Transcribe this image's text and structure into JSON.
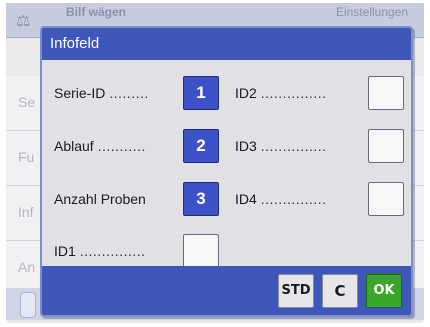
{
  "background": {
    "header_left": "Bilf wägen",
    "header_right": "Einstellungen",
    "rows": [
      "Se",
      "Fu",
      "Inf",
      "An"
    ]
  },
  "dialog": {
    "title": "Infofeld",
    "left_fields": [
      {
        "label": "Serie-ID",
        "dots": ".........",
        "value": "1"
      },
      {
        "label": "Ablauf",
        "dots": "...........",
        "value": "2"
      },
      {
        "label": "Anzahl Proben",
        "dots": "",
        "value": "3"
      },
      {
        "label": "ID1",
        "dots": "...............",
        "value": ""
      }
    ],
    "right_fields": [
      {
        "label": "ID2",
        "dots": "...............",
        "value": ""
      },
      {
        "label": "ID3",
        "dots": "...............",
        "value": ""
      },
      {
        "label": "ID4",
        "dots": "...............",
        "value": ""
      }
    ],
    "buttons": {
      "std": "STD",
      "c": "C",
      "ok": "OK"
    }
  },
  "colors": {
    "title_bar": "#3e57b9",
    "selected_box": "#3d52c9",
    "ok_button": "#3aa62a"
  }
}
